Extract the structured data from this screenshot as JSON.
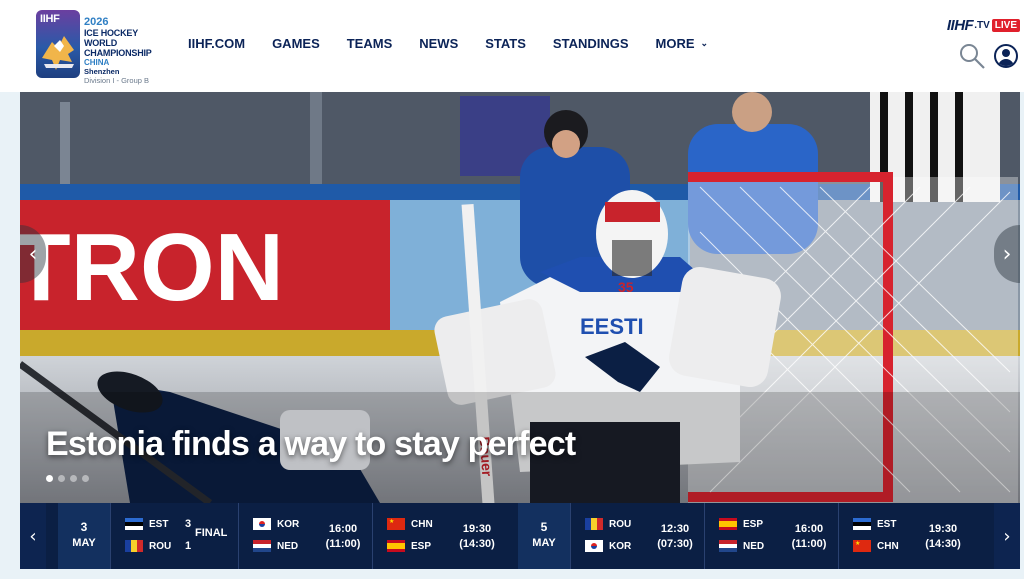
{
  "logo": {
    "badge": "IIHF",
    "year": "2026",
    "line1": "ICE HOCKEY",
    "line2": "WORLD",
    "line3": "CHAMPIONSHIP",
    "country": "CHINA",
    "city": "Shenzhen",
    "division": "Division I - Group B"
  },
  "nav": {
    "items": [
      {
        "label": "IIHF.COM"
      },
      {
        "label": "GAMES"
      },
      {
        "label": "TEAMS"
      },
      {
        "label": "NEWS"
      },
      {
        "label": "STATS"
      },
      {
        "label": "STANDINGS"
      },
      {
        "label": "MORE"
      }
    ]
  },
  "tv": {
    "brand": "IIHF",
    "suffix": ".TV",
    "live": "LIVE"
  },
  "hero": {
    "headline": "Estonia finds a way to stay perfect",
    "banner_text": "TRON",
    "jersey_text": "EESTI",
    "jersey_number": "35",
    "stick_text": "Bauer",
    "slides": 4,
    "active_slide": 1
  },
  "scores": {
    "dates": [
      {
        "day": "3",
        "month": "MAY"
      },
      {
        "day": "5",
        "month": "MAY"
      }
    ],
    "games": [
      {
        "home": "EST",
        "away": "ROU",
        "home_score": "3",
        "away_score": "1",
        "status": "FINAL",
        "home_flag": "est",
        "away_flag": "rou"
      },
      {
        "home": "KOR",
        "away": "NED",
        "time": "16:00",
        "local_time": "(11:00)",
        "home_flag": "kor",
        "away_flag": "ned"
      },
      {
        "home": "CHN",
        "away": "ESP",
        "time": "19:30",
        "local_time": "(14:30)",
        "home_flag": "chn",
        "away_flag": "esp"
      },
      {
        "home": "ROU",
        "away": "KOR",
        "time": "12:30",
        "local_time": "(07:30)",
        "home_flag": "rou",
        "away_flag": "kor"
      },
      {
        "home": "ESP",
        "away": "NED",
        "time": "16:00",
        "local_time": "(11:00)",
        "home_flag": "esp",
        "away_flag": "ned"
      },
      {
        "home": "EST",
        "away": "CHN",
        "time": "19:30",
        "local_time": "(14:30)",
        "home_flag": "est",
        "away_flag": "chn"
      }
    ]
  },
  "icons": {
    "search": "search-icon",
    "user": "user-icon",
    "prev": "chevron-left-icon",
    "next": "chevron-right-icon",
    "more": "chevron-down-icon"
  },
  "colors": {
    "nav_text": "#0b2357",
    "scores_bg": "#0b1f44",
    "live_red": "#e0202c",
    "accent_blue": "#2f7fc4"
  }
}
